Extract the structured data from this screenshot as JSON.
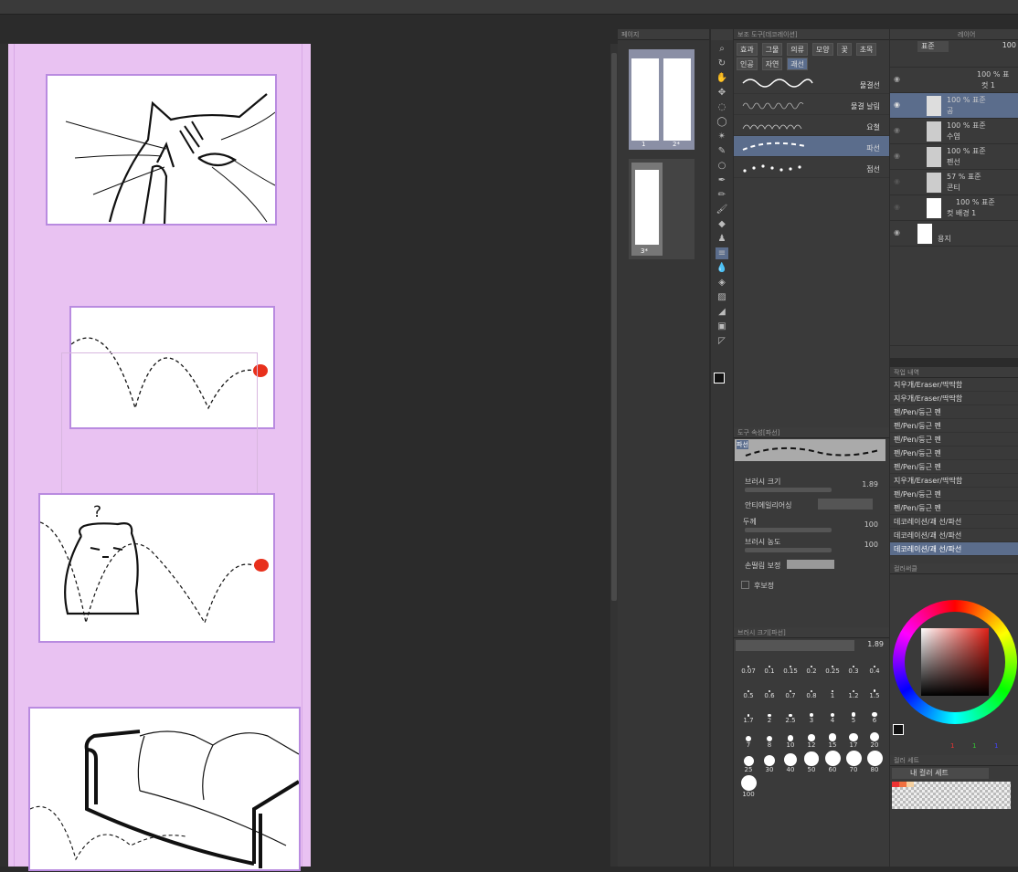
{
  "navigator": {
    "header": "페이지"
  },
  "thumbnails": [
    {
      "label": "1"
    },
    {
      "label": "2*"
    },
    {
      "label": "3*"
    }
  ],
  "subtool": {
    "header": "보조 도구[데코레이션]",
    "buttons": [
      "효과",
      "그물",
      "의류",
      "모양",
      "꽃",
      "초목",
      "인공",
      "자연"
    ],
    "group": "괘선",
    "brushes": [
      {
        "name": "물결선"
      },
      {
        "name": "물결 날림"
      },
      {
        "name": "요철"
      },
      {
        "name": "파선"
      },
      {
        "name": "점선"
      }
    ]
  },
  "toolprop": {
    "header": "도구 속성[파선]",
    "tag": "파선",
    "rows": [
      {
        "label": "브러시 크기",
        "value": "1.89"
      },
      {
        "label": "안티에일리어싱",
        "value": ""
      },
      {
        "label": "두께",
        "value": "100"
      },
      {
        "label": "브러시 농도",
        "value": "100"
      },
      {
        "label": "손떨림 보정",
        "value": ""
      },
      {
        "label": "후보정",
        "value": ""
      }
    ]
  },
  "brushsize": {
    "header": "브러시 크기[파선]",
    "value": "1.89",
    "sizes": [
      "0.07",
      "0.1",
      "0.15",
      "0.2",
      "0.25",
      "0.3",
      "0.4",
      "0.5",
      "0.6",
      "0.7",
      "0.8",
      "1",
      "1.2",
      "1.5",
      "1.7",
      "2",
      "2.5",
      "3",
      "4",
      "5",
      "6",
      "7",
      "8",
      "10",
      "12",
      "15",
      "17",
      "20",
      "25",
      "30",
      "40",
      "50",
      "60",
      "70",
      "80",
      "100"
    ]
  },
  "layers": {
    "tab_layer": "레이어",
    "blend": "표준",
    "opacity": "100",
    "items": [
      {
        "pct": "100 % 표",
        "name": "컷 1"
      },
      {
        "pct": "100 % 표준",
        "name": "공"
      },
      {
        "pct": "100 % 표준",
        "name": "수염"
      },
      {
        "pct": "100 % 표준",
        "name": "펜선"
      },
      {
        "pct": "57 % 표준",
        "name": "콘티"
      },
      {
        "pct": "100 % 표준",
        "name": "컷 배경 1"
      },
      {
        "pct": "",
        "name": "용지"
      }
    ]
  },
  "history": {
    "header": "작업 내역",
    "items": [
      "지우개/Eraser/딱딱함",
      "지우개/Eraser/딱딱함",
      "펜/Pen/둥근 펜",
      "펜/Pen/둥근 펜",
      "펜/Pen/둥근 펜",
      "펜/Pen/둥근 펜",
      "펜/Pen/둥근 펜",
      "지우개/Eraser/딱딱함",
      "펜/Pen/둥근 펜",
      "펜/Pen/둥근 펜",
      "데코레이션/괘 선/파선",
      "데코레이션/괘 선/파선",
      "데코레이션/괘 선/파선"
    ]
  },
  "colorwheel": {
    "header": "컬러써클",
    "rgb": [
      "1",
      "1",
      "1"
    ]
  },
  "colorset": {
    "header": "컬러 세트",
    "name": "내 컬러 세트"
  },
  "canvas": {
    "question_mark": "?"
  }
}
